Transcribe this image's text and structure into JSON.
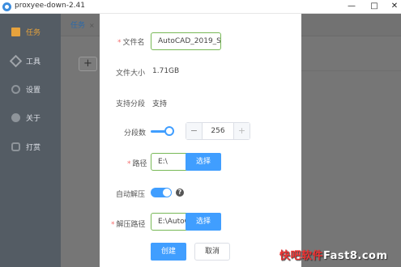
{
  "window": {
    "title": "proxyee-down-2.41"
  },
  "sidebar": {
    "items": [
      {
        "label": "任务",
        "icon": "task-icon"
      },
      {
        "label": "工具",
        "icon": "tools-icon"
      },
      {
        "label": "设置",
        "icon": "gear-icon"
      },
      {
        "label": "关于",
        "icon": "info-icon"
      },
      {
        "label": "打赏",
        "icon": "reward-icon"
      }
    ]
  },
  "main": {
    "tab_label": "任务",
    "tab_close": "×",
    "add_label": "+"
  },
  "dialog": {
    "file_name": {
      "label": "文件名",
      "value": "AutoCAD_2019_S"
    },
    "file_size": {
      "label": "文件大小",
      "value": "1.71GB"
    },
    "segment_support": {
      "label": "支持分段",
      "value": "支持"
    },
    "segments": {
      "label": "分段数",
      "value": "256",
      "minus": "−",
      "plus": "+"
    },
    "path": {
      "label": "路径",
      "value": "E:\\",
      "button": "选择"
    },
    "auto_extract": {
      "label": "自动解压",
      "help": "?"
    },
    "extract_path": {
      "label": "解压路径",
      "value": "E:\\AutoCA",
      "button": "选择"
    },
    "create_button": "创建",
    "cancel_button": "取消"
  },
  "watermark": {
    "part1": "快吧软件",
    "part2": "Fast8.com"
  },
  "colors": {
    "accent": "#409eff",
    "sidebar": "#545c64",
    "active": "#e6a23c"
  }
}
